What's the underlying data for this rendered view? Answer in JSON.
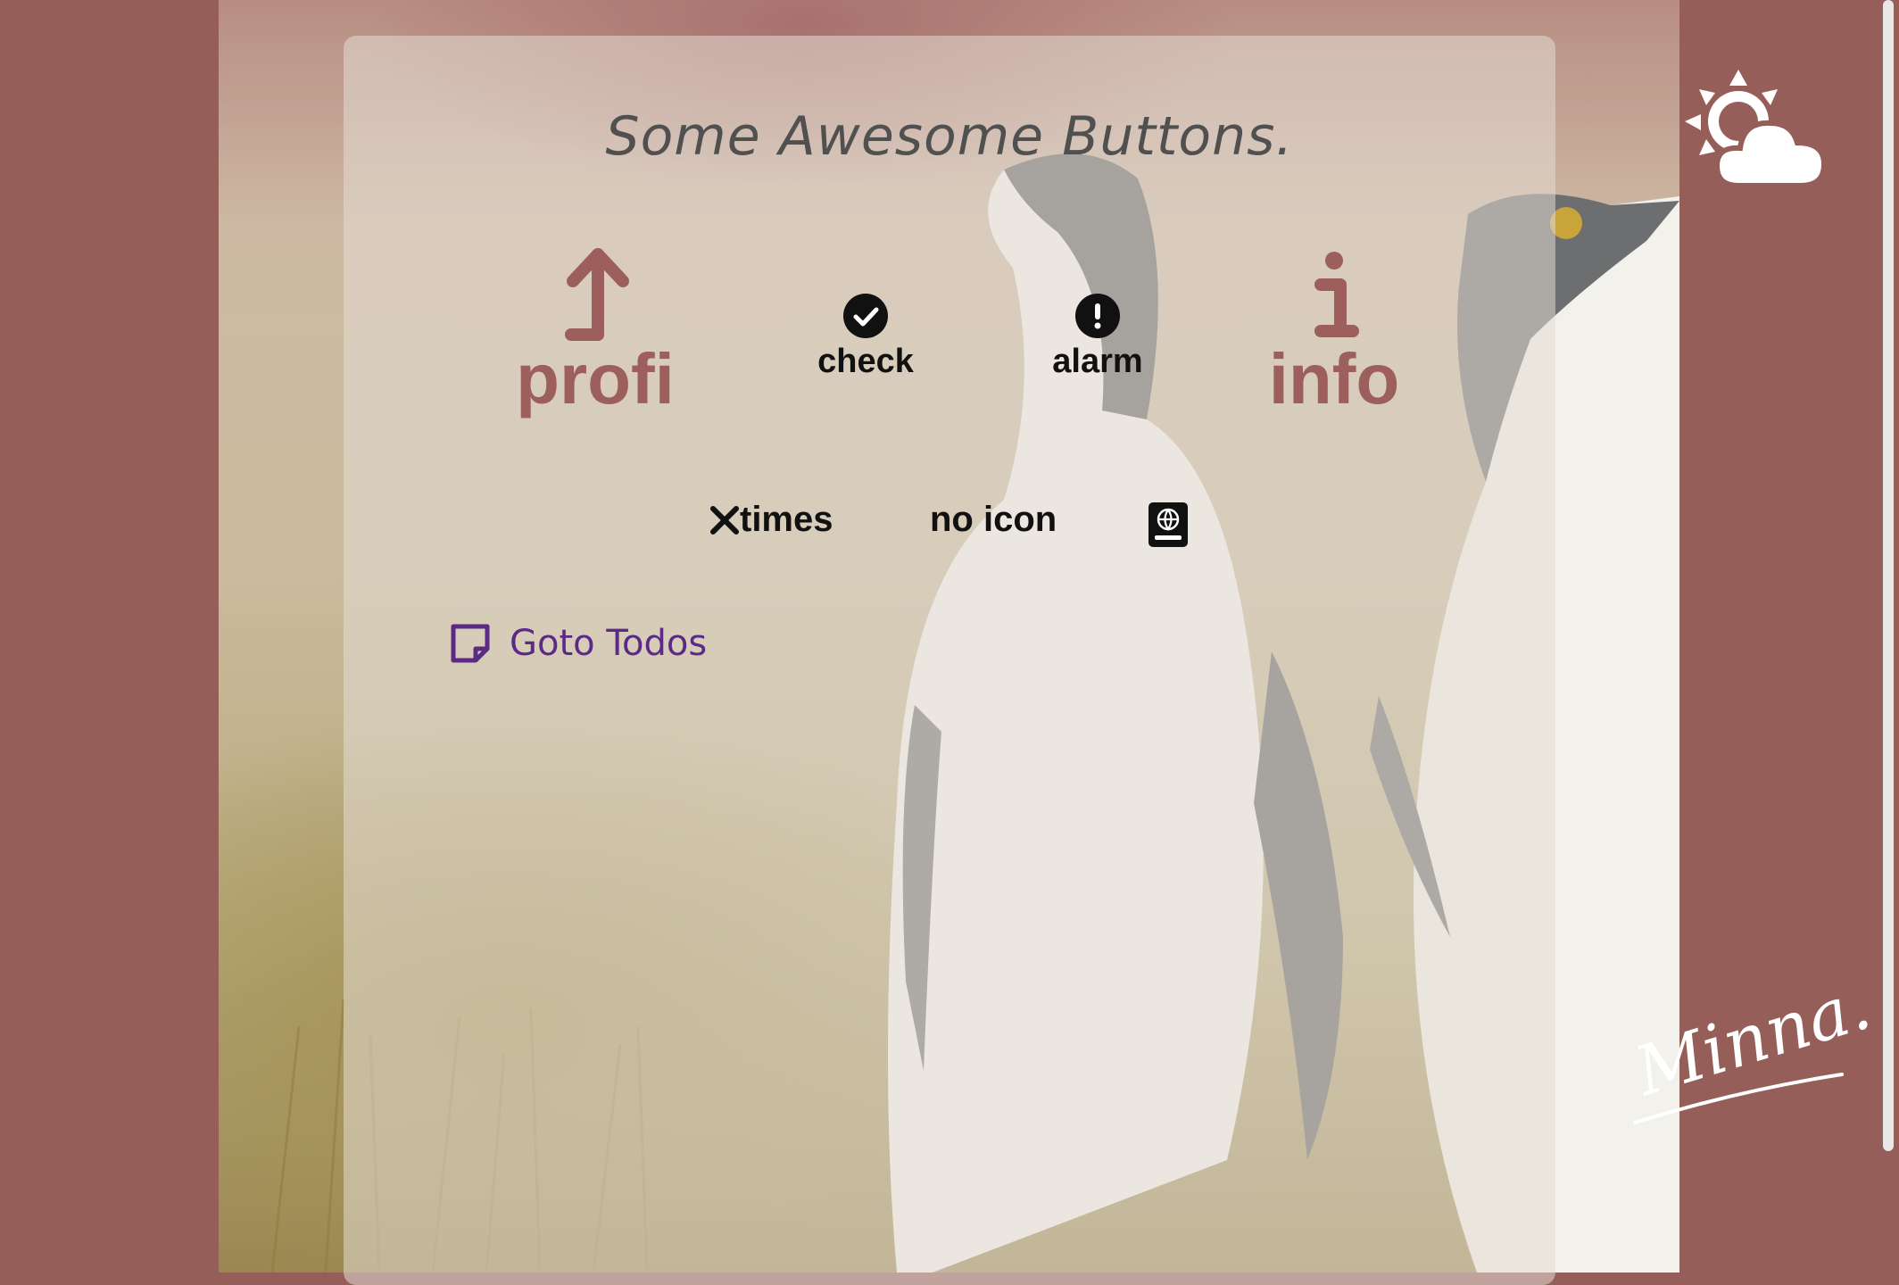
{
  "header": {
    "title": "Some Awesome Buttons."
  },
  "buttons_row1": [
    {
      "label": "profi",
      "icon": "arrow-up-icon",
      "color": "#9c5f5c"
    },
    {
      "label": "check",
      "icon": "check-circle-icon",
      "color": "#111111"
    },
    {
      "label": "alarm",
      "icon": "exclamation-circle-icon",
      "color": "#111111"
    },
    {
      "label": "info",
      "icon": "info-icon",
      "color": "#9c5f5c"
    }
  ],
  "buttons_row2": [
    {
      "label": "times",
      "icon": "times-icon"
    },
    {
      "label": "no icon"
    },
    {
      "label": "",
      "icon": "atlas-book-icon"
    }
  ],
  "nav": {
    "goto_label": "Goto Todos",
    "goto_icon": "sticky-note-icon",
    "color": "#5b2a86"
  },
  "sidebar": {
    "weather_icon": "sun-cloud-icon",
    "signature": "Minna."
  },
  "colors": {
    "background": "#955e59",
    "accent": "#9c5f5c",
    "link": "#5b2a86"
  }
}
